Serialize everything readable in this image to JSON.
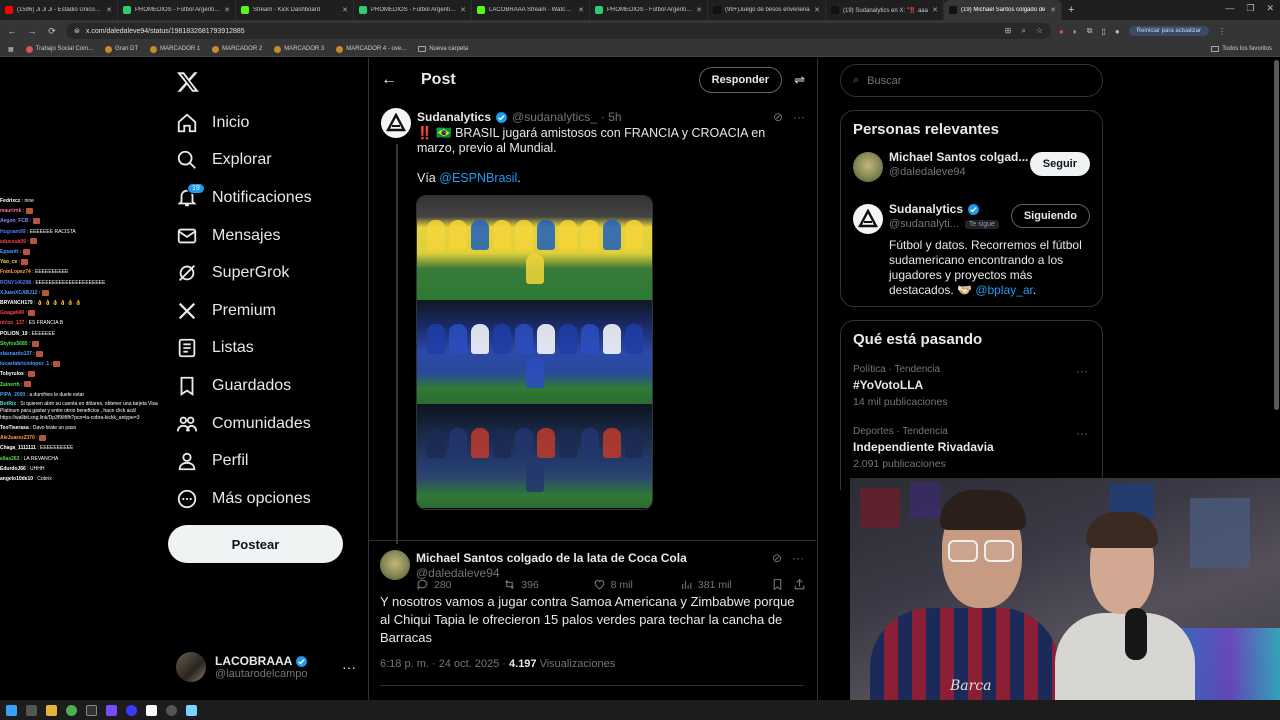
{
  "browser": {
    "tabs": [
      {
        "title": "(1596) Ji Ji Ji - Estadio Único de",
        "color": "#ff0000"
      },
      {
        "title": "PROMEDIOS - Futbol Argentino",
        "color": "#2ecc71"
      },
      {
        "title": "Stream - Kick Dashboard",
        "color": "#53fc18"
      },
      {
        "title": "PROMEDIOS - Futbol Argentino",
        "color": "#2ecc71"
      },
      {
        "title": "LACOBRAAA Stream - Watch Li",
        "color": "#53fc18"
      },
      {
        "title": "PROMEDIOS - Futbol Argentino",
        "color": "#2ecc71"
      },
      {
        "title": "(99+)Juego de besos envenena",
        "color": "#111111"
      },
      {
        "title": "(19) Sudanalytics en X: \"‼️ aaa",
        "color": "#111111"
      },
      {
        "title": "(19) Michael Santos colgado de",
        "color": "#111111",
        "active": true
      }
    ],
    "url": "x.com/daledaleve94/status/1981832681793912885",
    "update_label": "Reiniciar para actualizar",
    "bookmarks": [
      "Trabajo Social Com...",
      "Gran DT",
      "MARCADOR 1",
      "MARCADOR 2",
      "MARCADOR 3",
      "MARCADOR 4 - ove...",
      "Nueva carpeta"
    ],
    "all_bookmarks": "Todos los favoritos"
  },
  "chat": [
    {
      "user": "Fedrixcz",
      "msg": "nine",
      "color": "#ffffff"
    },
    {
      "user": "maurirnk",
      "msg": "",
      "color": "#ff6b9d",
      "emote": true
    },
    {
      "user": "Aegon_FCB",
      "msg": "",
      "color": "#8a8aff",
      "emote": true
    },
    {
      "user": "Hugoam99",
      "msg": "EEEEEEE RACISTA",
      "color": "#4a7dff"
    },
    {
      "user": "eduvsuk09",
      "msg": "",
      "color": "#ff4444",
      "emote": true
    },
    {
      "user": "Epsantt",
      "msg": "",
      "color": "#4a9dff",
      "emote": true
    },
    {
      "user": "Yao_ce",
      "msg": "",
      "color": "#ffd84a",
      "emote": true
    },
    {
      "user": "FranLopez74",
      "msg": "EEEEEEEEEE",
      "color": "#ff9d4a"
    },
    {
      "user": "RONY140298",
      "msg": "EEEEEEEEEEEEEEEEEEEEE",
      "color": "#4a7dff"
    },
    {
      "user": "XJuanXCABJ12",
      "msg": "",
      "color": "#4a9dff",
      "emote": true
    },
    {
      "user": "BRYANCH179",
      "msg": "👌 👌 👌 👌 👌 👌",
      "color": "#ffffff"
    },
    {
      "user": "Guagalt40",
      "msg": "",
      "color": "#ff4444",
      "emote": true
    },
    {
      "user": "nicoo_137",
      "msg": "ES FRANCIA B",
      "color": "#ff4444"
    },
    {
      "user": "POLION_19",
      "msg": "EEEEEEE",
      "color": "#ffffff"
    },
    {
      "user": "Skyfox5685",
      "msg": "",
      "color": "#4ae34a",
      "emote": true
    },
    {
      "user": "xlasnardo137",
      "msg": "",
      "color": "#4a9dff",
      "emote": true
    },
    {
      "user": "lucasfabriciolopez_1",
      "msg": "",
      "color": "#4a9dff",
      "emote": true
    },
    {
      "user": "Tobyrulos",
      "msg": "",
      "color": "#ffffff",
      "emote": true
    },
    {
      "user": "Zainerth",
      "msg": "",
      "color": "#4ae34a",
      "emote": true
    },
    {
      "user": "PIPA_2000",
      "msg": "a dumfries le duele estar",
      "color": "#4a9dff"
    },
    {
      "user": "BotRix",
      "msg": "Si quieren abrir su cuenta en dólares, obtener una tarjeta Visa Platinum para gastar y entre otros beneficios , hace click acá! https://wallbit.sng.link/Dp3f9/if/fh?pcn=la-cobra-kickk_antype=3",
      "color": "#4ae3e3"
    },
    {
      "user": "TeoTiserasa",
      "msg": "Davo tirate un paso",
      "color": "#ffffff"
    },
    {
      "user": "AleJuarez2370",
      "msg": "",
      "color": "#ff9d4a",
      "emote": true
    },
    {
      "user": "Chaga_1111111",
      "msg": "EEEEEEEEEE",
      "color": "#ffffff"
    },
    {
      "user": "ellas263",
      "msg": "LA REVANCHA",
      "color": "#4ae34a"
    },
    {
      "user": "EdurdoJ66",
      "msg": "UHHH",
      "color": "#ffffff"
    },
    {
      "user": "angelo10de10",
      "msg": "Cobrix",
      "color": "#ffffff"
    }
  ],
  "nav": {
    "items": [
      {
        "label": "Inicio",
        "icon": "home-icon"
      },
      {
        "label": "Explorar",
        "icon": "search-icon"
      },
      {
        "label": "Notificaciones",
        "icon": "bell-icon",
        "badge": "19"
      },
      {
        "label": "Mensajes",
        "icon": "mail-icon"
      },
      {
        "label": "SuperGrok",
        "icon": "grok-icon"
      },
      {
        "label": "Premium",
        "icon": "x-icon"
      },
      {
        "label": "Listas",
        "icon": "list-icon"
      },
      {
        "label": "Guardados",
        "icon": "bookmark-icon"
      },
      {
        "label": "Comunidades",
        "icon": "communities-icon"
      },
      {
        "label": "Perfil",
        "icon": "user-icon"
      },
      {
        "label": "Más opciones",
        "icon": "more-icon"
      }
    ],
    "post_button": "Postear",
    "account": {
      "name": "LACOBRAAA",
      "handle": "@lautarodelcampo"
    }
  },
  "main": {
    "title": "Post",
    "reply_button": "Responder",
    "quoted": {
      "name": "Sudanalytics",
      "handle": "@sudanalytics_",
      "time": "· 5h",
      "text_1": "‼️ 🇧🇷 BRASIL jugará amistosos con FRANCIA y CROACIA en marzo, previo al Mundial.",
      "via": "Vía ",
      "via_link": "@ESPNBrasil",
      "via_end": ".",
      "replies": "280",
      "reposts": "396",
      "likes": "8 mil",
      "views": "381 mil"
    },
    "post": {
      "name": "Michael Santos colgado de la lata de Coca Cola",
      "handle": "@daledaleve94",
      "text": "Y nosotros vamos a jugar contra Samoa Americana y Zimbabwe porque al Chiqui Tapia le ofrecieron 15 palos verdes para techar la cancha de Barracas",
      "time": "6:18 p. m. · 24 oct. 2025 · ",
      "views_count": "4.197",
      "views_label": " Visualizaciones"
    }
  },
  "right": {
    "search_placeholder": "Buscar",
    "relevant_title": "Personas relevantes",
    "people": [
      {
        "name": "Michael Santos colgad...",
        "handle": "@daledaleve94",
        "button": "Seguir"
      },
      {
        "name": "Sudanalytics",
        "handle": "@sudanalyti...",
        "follows_you": "Te sigue",
        "button": "Siguiendo",
        "bio": "Fútbol y datos. Recorremos el fútbol sudamericano encontrando a los jugadores y proyectos más destacados. 🫱🏻‍🫲🏼 ",
        "bio_link": "@bplay_ar",
        "bio_end": "."
      }
    ],
    "trends_title": "Qué está pasando",
    "trends": [
      {
        "category": "Política · Tendencia",
        "name": "#YoVotoLLA",
        "count": "14 mil publicaciones"
      },
      {
        "category": "Deportes · Tendencia",
        "name": "Independiente Rivadavia",
        "count": "2.091 publicaciones"
      }
    ]
  },
  "webcam_overlay_text": "Barca"
}
